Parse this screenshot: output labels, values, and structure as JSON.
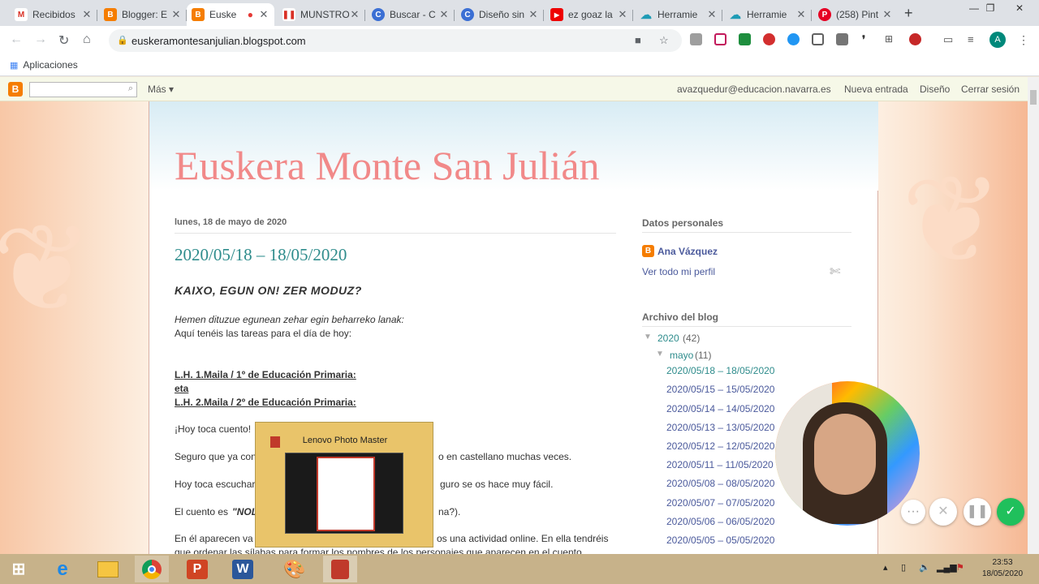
{
  "browser": {
    "tabs": [
      {
        "label": "Recibidos",
        "icon": "gmail-icon",
        "color": "#d93025"
      },
      {
        "label": "Blogger: E",
        "icon": "blogger-icon",
        "color": "#f57d00"
      },
      {
        "label": "Euske",
        "icon": "blogger-icon",
        "color": "#f57d00",
        "active": true
      },
      {
        "label": "MUNSTRO",
        "icon": "pause-icon",
        "color": "#d93025"
      },
      {
        "label": "Buscar - C",
        "icon": "canva-icon",
        "color": "#3b6fd4"
      },
      {
        "label": "Diseño sin",
        "icon": "canva-icon",
        "color": "#3b6fd4"
      },
      {
        "label": "ez goaz la",
        "icon": "youtube-icon",
        "color": "#e00"
      },
      {
        "label": "Herramie",
        "icon": "cloud-icon",
        "color": "#1e9bb5"
      },
      {
        "label": "Herramie",
        "icon": "cloud-icon",
        "color": "#1e9bb5"
      },
      {
        "label": "(258) Pint",
        "icon": "pinterest-icon",
        "color": "#e60023"
      }
    ],
    "new_tab": "+",
    "url": "euskeramontesanjulian.blogspot.com",
    "bookmarks_apps": "Aplicaciones",
    "profile_initial": "A"
  },
  "blogger_nav": {
    "more": "Más",
    "email": "avazquedur@educacion.navarra.es",
    "new_post": "Nueva entrada",
    "design": "Diseño",
    "logout": "Cerrar sesión"
  },
  "blog": {
    "title": "Euskera Monte San Julián",
    "post_date": "lunes, 18 de mayo de 2020",
    "post_title": "2020/05/18 – 18/05/2020",
    "greeting": "KAIXO, EGUN ON! ZER MODUZ?",
    "intro_eu": "Hemen dituzue egunean zehar egin beharreko lanak:",
    "intro_es": "Aquí tenéis las tareas para el día de hoy:",
    "grade1": "L.H. 1.Maila / 1º de Educación Primaria:",
    "eta": "eta",
    "grade2": "L.H. 2.Maila / 2º de Educación Primaria:",
    "p1": "¡Hoy toca cuento!",
    "p2a": "Seguro que ya con",
    "p2b": "o en castellano muchas veces.",
    "p3a": "Hoy toca escuchar",
    "p3b": "guro se os hace muy fácil.",
    "p4a": "El cuento es",
    "p4b": "\"NOL",
    "p4c": "na?).",
    "p5a": "En él aparecen va",
    "p5b": "os una actividad online. En ella tendréis",
    "p6": "que ordenar las sílabas para formar los nombres de los personajes que aparecen en el cuento."
  },
  "sidebar": {
    "profile_heading": "Datos personales",
    "profile_name": "Ana Vázquez",
    "profile_link": "Ver todo mi perfil",
    "archive_heading": "Archivo del blog",
    "year": "2020",
    "year_count": "(42)",
    "month": "mayo",
    "month_count": "(11)",
    "posts": [
      "2020/05/18 – 18/05/2020",
      "2020/05/15 – 15/05/2020",
      "2020/05/14 – 14/05/2020",
      "2020/05/13 – 13/05/2020",
      "2020/05/12 – 12/05/2020",
      "2020/05/11 – 11/05/2020",
      "2020/05/08 – 08/05/2020",
      "2020/05/07 – 07/05/2020",
      "2020/05/06 – 06/05/2020",
      "2020/05/05 – 05/05/2020"
    ]
  },
  "popup": {
    "title": "Lenovo Photo Master"
  },
  "taskbar": {
    "time": "23:53",
    "date": "18/05/2020",
    "apps": [
      "windows-start-icon",
      "internet-explorer-icon",
      "file-explorer-icon",
      "chrome-icon",
      "powerpoint-icon",
      "word-icon",
      "paint-icon",
      "photo-master-icon"
    ]
  },
  "colors": {
    "accent_teal": "#2e8c8c",
    "title_pink": "#f18989"
  }
}
